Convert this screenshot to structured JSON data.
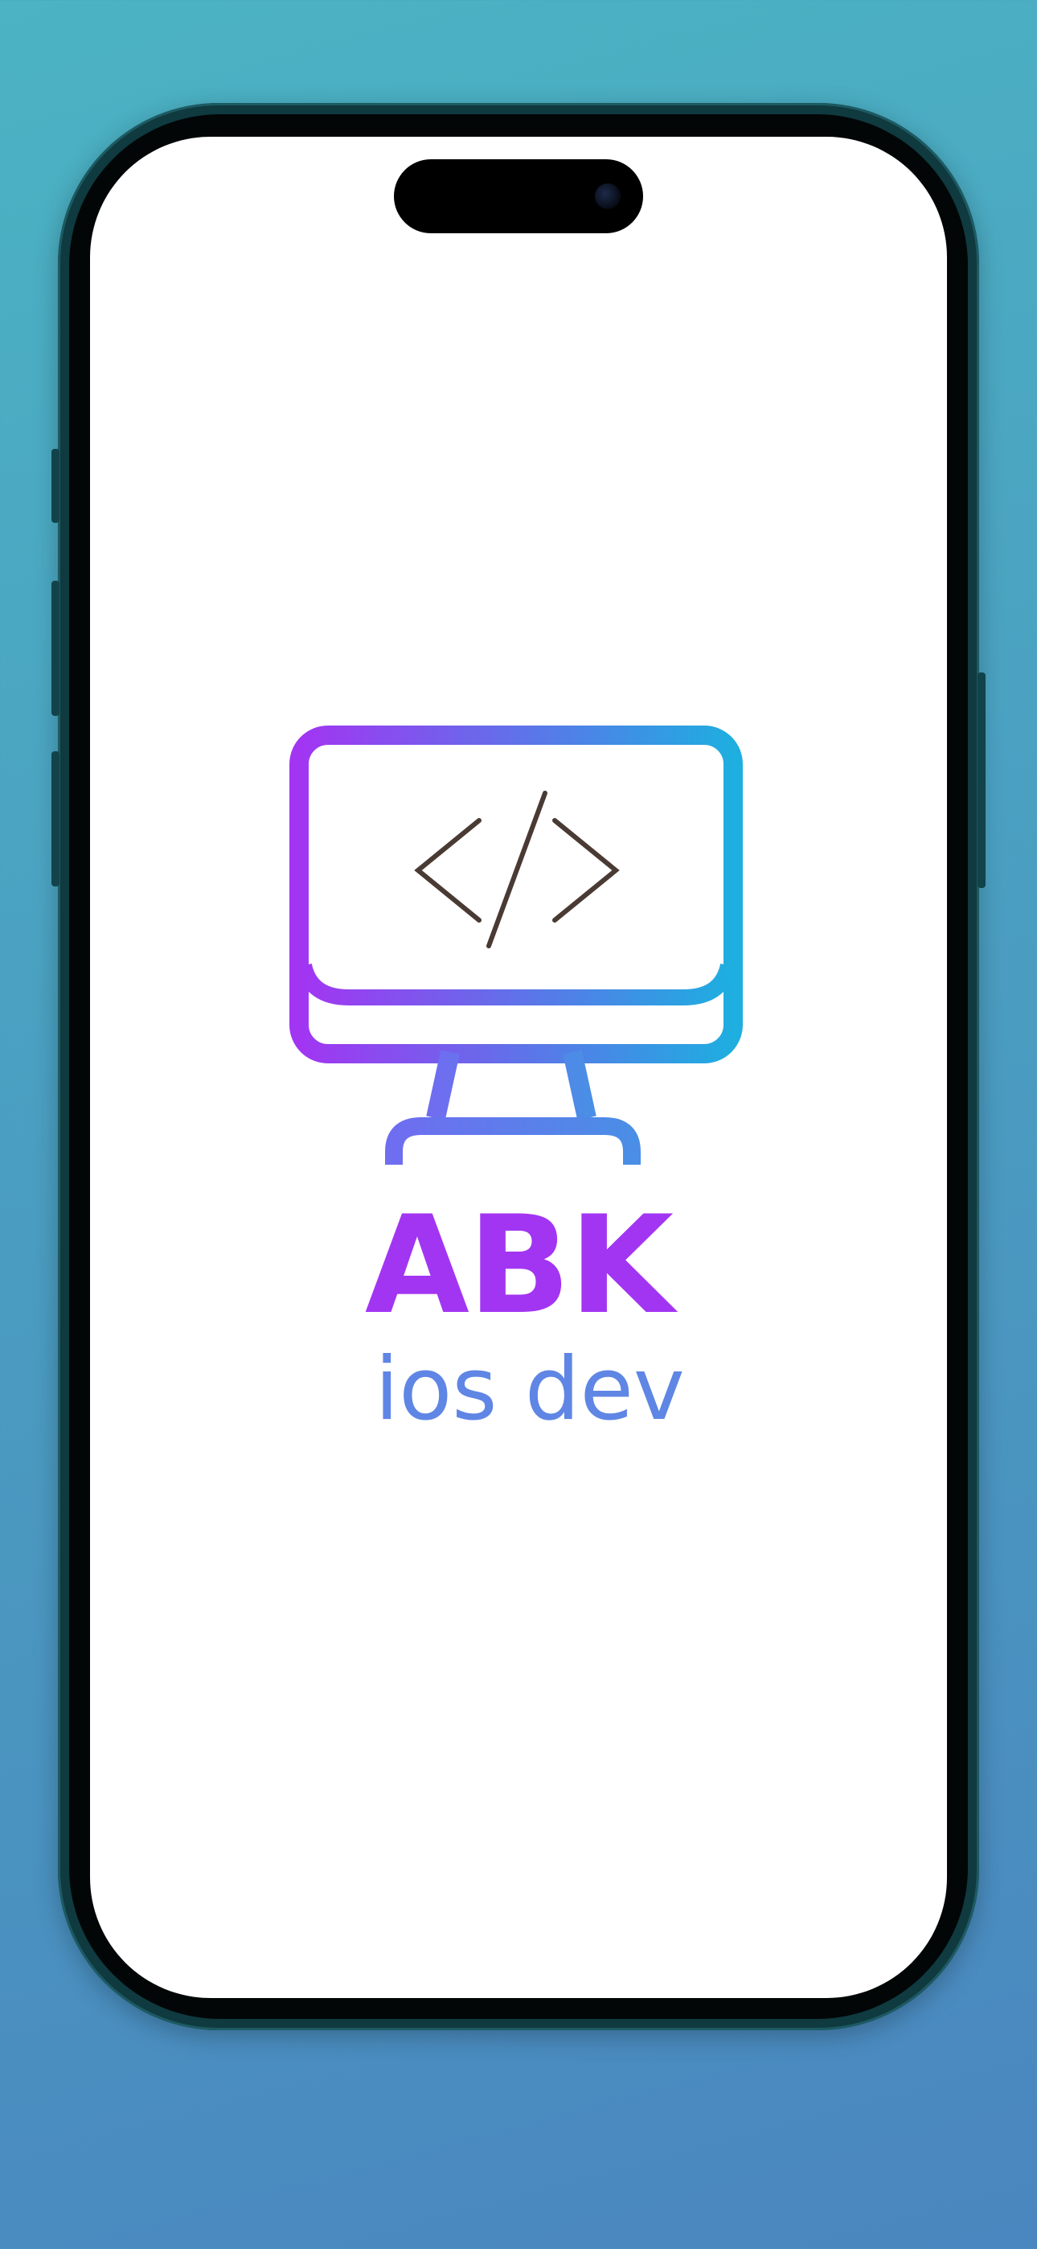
{
  "brand": {
    "title": "ABK",
    "subtitle": "ios dev"
  },
  "logo": {
    "icon": "monitor-code-icon",
    "gradient_start": "#a235f2",
    "gradient_end": "#1eaee0",
    "code_color": "#4a3a34"
  },
  "colors": {
    "background_top": "#4bb3c3",
    "background_bottom": "#4a86bf",
    "title": "#a235f2",
    "subtitle": "#5f86e5",
    "screen": "#ffffff"
  }
}
